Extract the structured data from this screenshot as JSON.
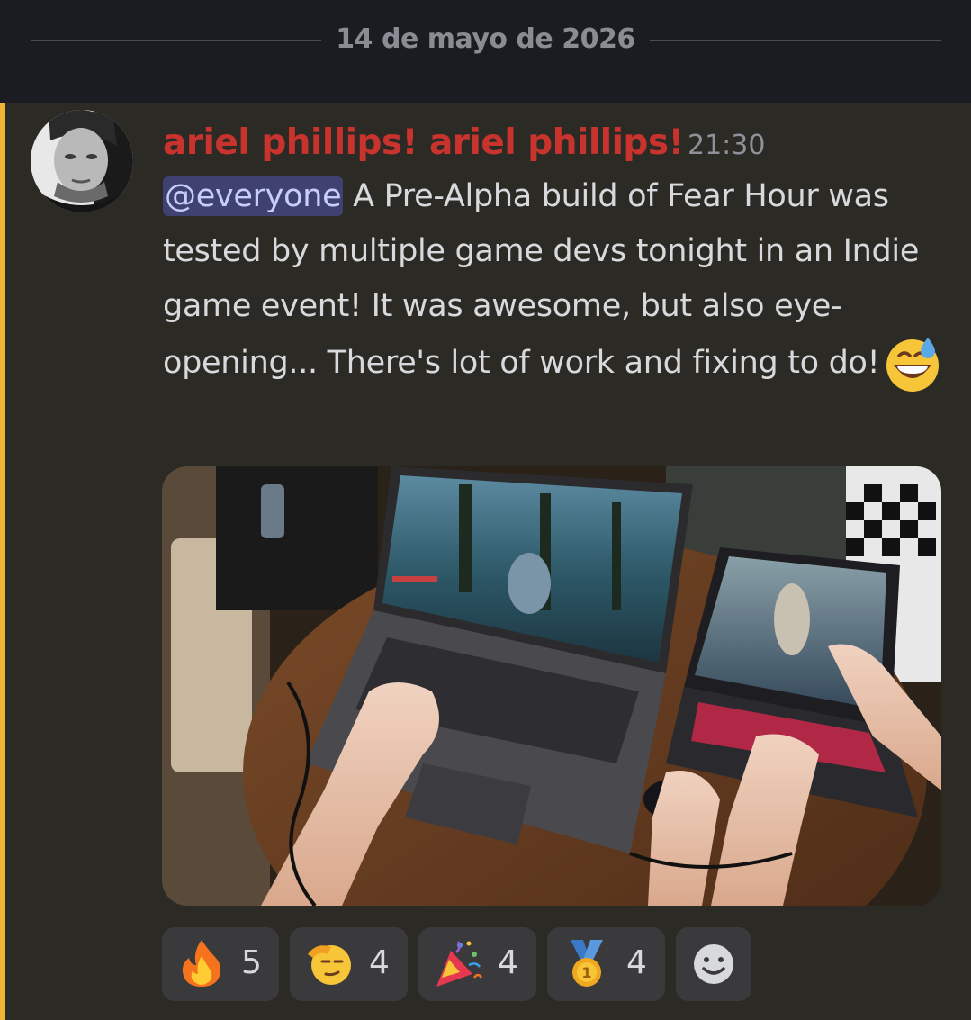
{
  "date_divider": {
    "label": "14 de mayo de 2026"
  },
  "message": {
    "author": "ariel phillips! ariel phillips!",
    "timestamp": "21:30",
    "mention": "@everyone",
    "text": " A Pre-Alpha build of Fear Hour was tested by multiple game devs tonight in an Indie game event! It was awesome, but also eye-opening... There's lot of work and fixing to do!",
    "inline_emoji": "grinning-face-with-sweat-icon",
    "author_color": "#c8332e",
    "mention_stripe_color": "#f0b232"
  },
  "reactions": [
    {
      "emoji": "fire-icon",
      "count": "5"
    },
    {
      "emoji": "saluting-face-icon",
      "count": "4"
    },
    {
      "emoji": "party-popper-icon",
      "count": "4"
    },
    {
      "emoji": "first-place-medal-icon",
      "count": "4"
    }
  ],
  "add_reaction": {
    "icon": "add-reaction-icon"
  }
}
